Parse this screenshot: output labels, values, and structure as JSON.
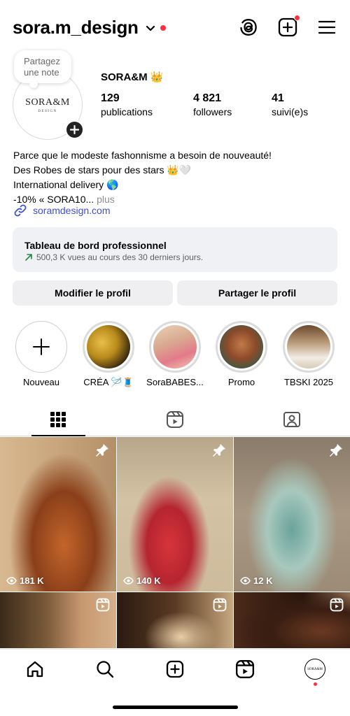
{
  "header": {
    "username": "sora.m_design"
  },
  "profile": {
    "note_line1": "Partagez",
    "note_line2": "une note",
    "logo_main": "SORA&M",
    "logo_sub": "DESIGN",
    "display_name": "SORA&M",
    "display_name_emoji": "👑",
    "stats": [
      {
        "num": "129",
        "label": "publications"
      },
      {
        "num": "4 821",
        "label": "followers"
      },
      {
        "num": "41",
        "label": "suivi(e)s"
      }
    ]
  },
  "bio": {
    "line1": "Parce que le modeste fashonnisme a besoin de nouveauté!",
    "line2": "Des Robes de stars pour des stars 👑🤍",
    "line3": "International delivery 🌎",
    "line4": "-10% « SORA10...",
    "more": "plus",
    "link": "soramdesign.com"
  },
  "dashboard": {
    "title": "Tableau de bord professionnel",
    "subtitle": "500,3 K vues au cours des 30 derniers jours."
  },
  "buttons": {
    "edit": "Modifier le profil",
    "share": "Partager le profil"
  },
  "highlights": [
    {
      "label": "Nouveau"
    },
    {
      "label": "CRÉA 🪡🧵"
    },
    {
      "label": "SoraBABES..."
    },
    {
      "label": "Promo"
    },
    {
      "label": "TBSKI 2025"
    }
  ],
  "posts": [
    {
      "views": "181 K",
      "pinned": true
    },
    {
      "views": "140 K",
      "pinned": true
    },
    {
      "views": "12 K",
      "pinned": true
    }
  ],
  "colors": {
    "accent_red": "#ff3040",
    "link_blue": "#3d51d6",
    "button_bg": "#efeff1"
  }
}
